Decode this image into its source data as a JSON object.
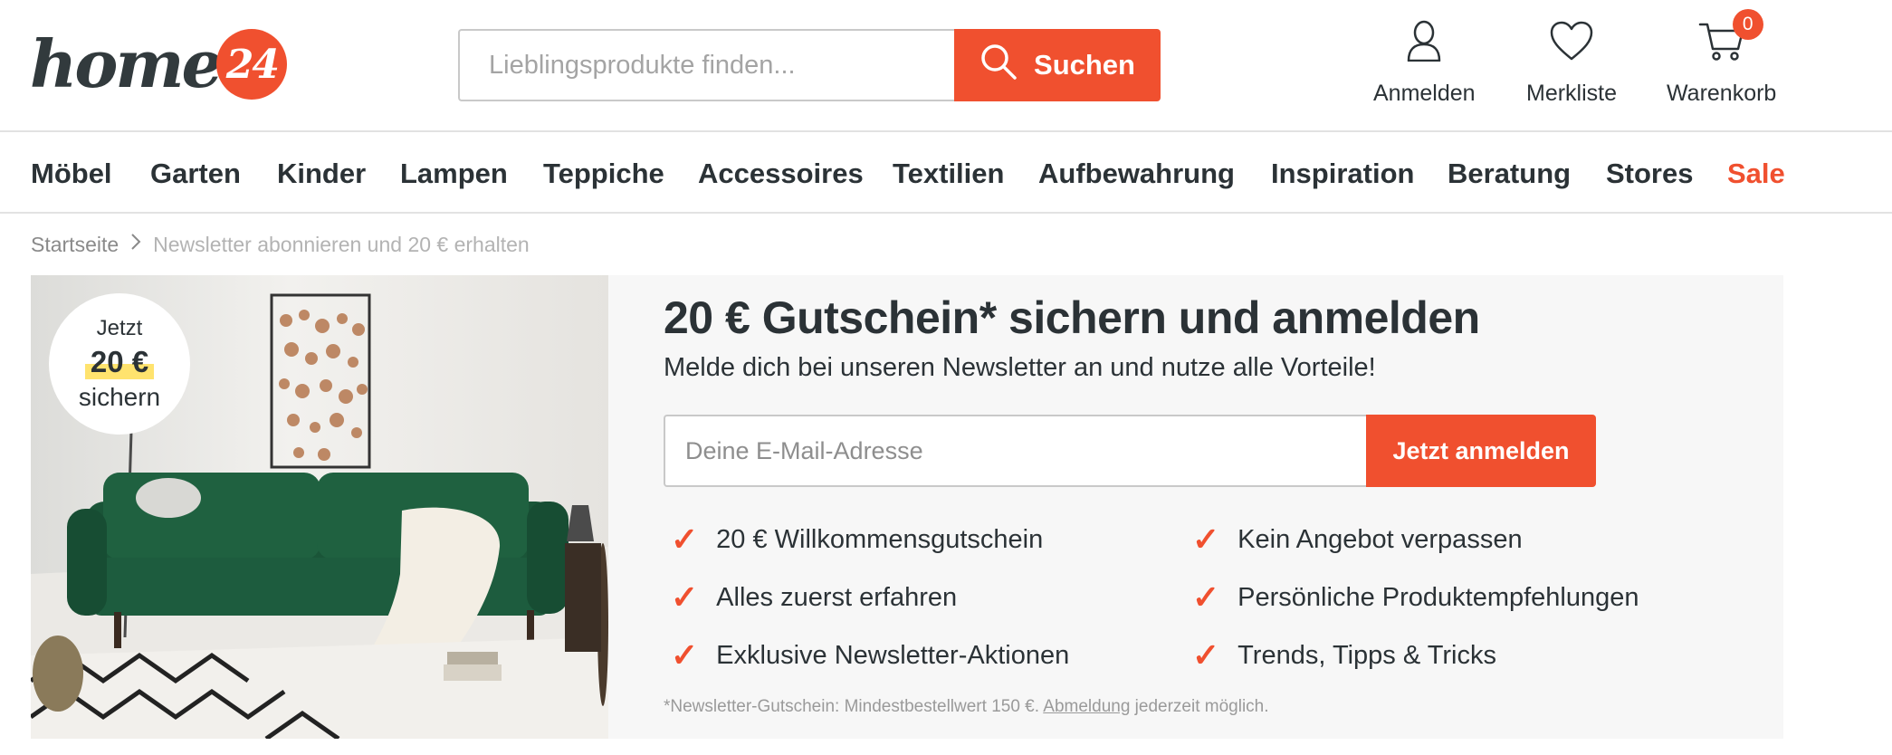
{
  "logo": {
    "word": "home",
    "badge": "24"
  },
  "search": {
    "placeholder": "Lieblingsprodukte finden...",
    "button_label": "Suchen"
  },
  "header_actions": [
    {
      "label": "Anmelden",
      "icon": "user-icon"
    },
    {
      "label": "Merkliste",
      "icon": "heart-icon"
    },
    {
      "label": "Warenkorb",
      "icon": "cart-icon",
      "badge": "0"
    }
  ],
  "nav": [
    {
      "label": "Möbel"
    },
    {
      "label": "Garten"
    },
    {
      "label": "Kinder"
    },
    {
      "label": "Lampen"
    },
    {
      "label": "Teppiche"
    },
    {
      "label": "Accessoires"
    },
    {
      "label": "Textilien"
    },
    {
      "label": "Aufbewahrung"
    },
    {
      "label": "Inspiration"
    },
    {
      "label": "Beratung"
    },
    {
      "label": "Stores"
    },
    {
      "label": "Sale"
    }
  ],
  "breadcrumb": {
    "home": "Startseite",
    "separator": ">",
    "current": "Newsletter abonnieren und 20 € erhalten"
  },
  "promo_badge": {
    "line1": "Jetzt",
    "line2": "20 €",
    "line3": "sichern"
  },
  "newsletter": {
    "headline": "20 € Gutschein* sichern und anmelden",
    "subline": "Melde dich bei unseren Newsletter an und nutze alle Vorteile!",
    "email_placeholder": "Deine E-Mail-Adresse",
    "button_label": "Jetzt anmelden",
    "benefits": [
      "20 € Willkommensgutschein",
      "Kein Angebot verpassen",
      "Alles zuerst erfahren",
      "Persönliche Produktempfehlungen",
      "Exklusive Newsletter-Aktionen",
      "Trends, Tipps & Tricks"
    ],
    "check_glyph": "✓",
    "footnote_before": "*Newsletter-Gutschein: Mindestbestellwert 150 €. ",
    "footnote_link": "Abmeldung",
    "footnote_after": " jederzeit möglich."
  },
  "colors": {
    "accent": "#f0502f",
    "text": "#2b3236",
    "highlight": "#ffe36e",
    "sofa": "#1d5c3e"
  }
}
